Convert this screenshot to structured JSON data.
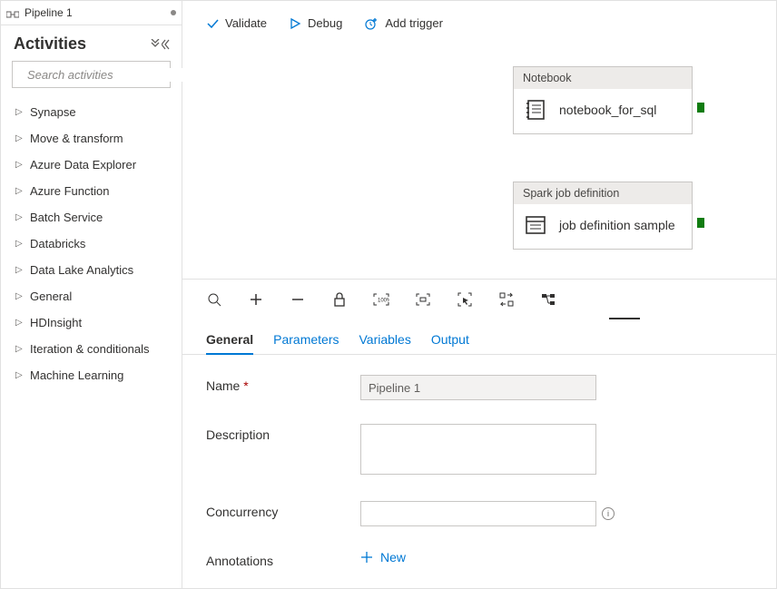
{
  "tab": {
    "title": "Pipeline 1"
  },
  "activities": {
    "title": "Activities",
    "search_placeholder": "Search activities",
    "items": [
      {
        "label": "Synapse"
      },
      {
        "label": "Move & transform"
      },
      {
        "label": "Azure Data Explorer"
      },
      {
        "label": "Azure Function"
      },
      {
        "label": "Batch Service"
      },
      {
        "label": "Databricks"
      },
      {
        "label": "Data Lake Analytics"
      },
      {
        "label": "General"
      },
      {
        "label": "HDInsight"
      },
      {
        "label": "Iteration & conditionals"
      },
      {
        "label": "Machine Learning"
      }
    ]
  },
  "toolbar": {
    "validate": "Validate",
    "debug": "Debug",
    "add_trigger": "Add trigger"
  },
  "nodes": {
    "notebook": {
      "head": "Notebook",
      "label": "notebook_for_sql"
    },
    "spark": {
      "head": "Spark job definition",
      "label": "job definition sample"
    }
  },
  "properties": {
    "tabs": {
      "general": "General",
      "parameters": "Parameters",
      "variables": "Variables",
      "output": "Output"
    },
    "fields": {
      "name_label": "Name",
      "name_value": "Pipeline 1",
      "description_label": "Description",
      "concurrency_label": "Concurrency",
      "annotations_label": "Annotations",
      "new_label": "New"
    }
  }
}
